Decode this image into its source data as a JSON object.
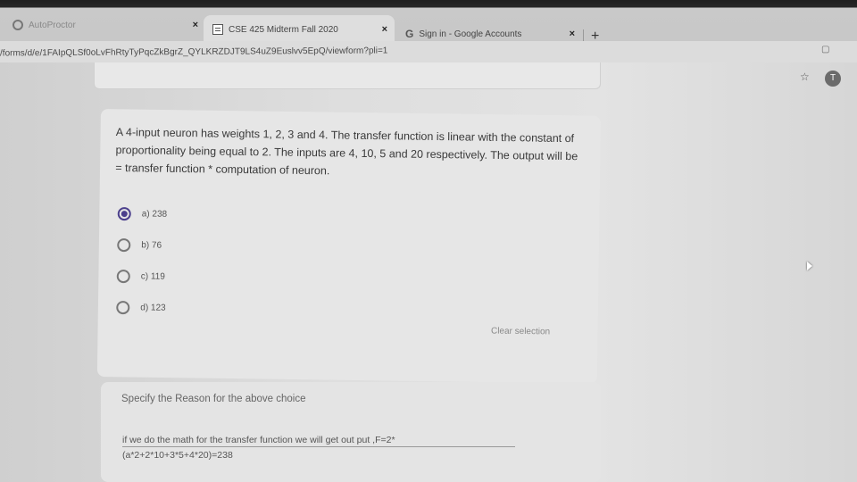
{
  "tabs": [
    {
      "title": "AutoProctor",
      "close": "×",
      "icon": "proctor-icon"
    },
    {
      "title": "CSE 425 Midterm Fall 2020",
      "close": "×",
      "icon": "forms-icon"
    },
    {
      "title": "Sign in - Google Accounts",
      "close": "×",
      "icon": "google-icon",
      "glyph": "G"
    }
  ],
  "new_tab": "+",
  "address_bar": {
    "url": "/forms/d/e/1FAIpQLSf0oLvFhRtyTyPqcZkBgrZ_QYLKRZDJT9LS4uZ9Euslvv5EpQ/viewform?pli=1"
  },
  "toolbar": {
    "star": "☆",
    "profile_initial": "T"
  },
  "question": {
    "text": "A 4-input neuron has weights 1, 2, 3 and 4. The transfer function is linear with the constant of proportionality being equal to 2. The inputs are 4, 10, 5 and 20 respectively. The output will be = transfer function * computation of neuron.",
    "options": [
      {
        "label": "a) 238",
        "checked": true
      },
      {
        "label": "b) 76",
        "checked": false
      },
      {
        "label": "c) 119",
        "checked": false
      },
      {
        "label": "d) 123",
        "checked": false
      }
    ],
    "clear_selection": "Clear selection"
  },
  "reason": {
    "label": "Specify the Reason for the above choice",
    "answer_line1": "if we do the math for the transfer function we will get out put ,F=2*",
    "answer_line2": "(a*2+2*10+3*5+4*20)=238"
  },
  "colors": {
    "accent": "#4b3f8c"
  }
}
